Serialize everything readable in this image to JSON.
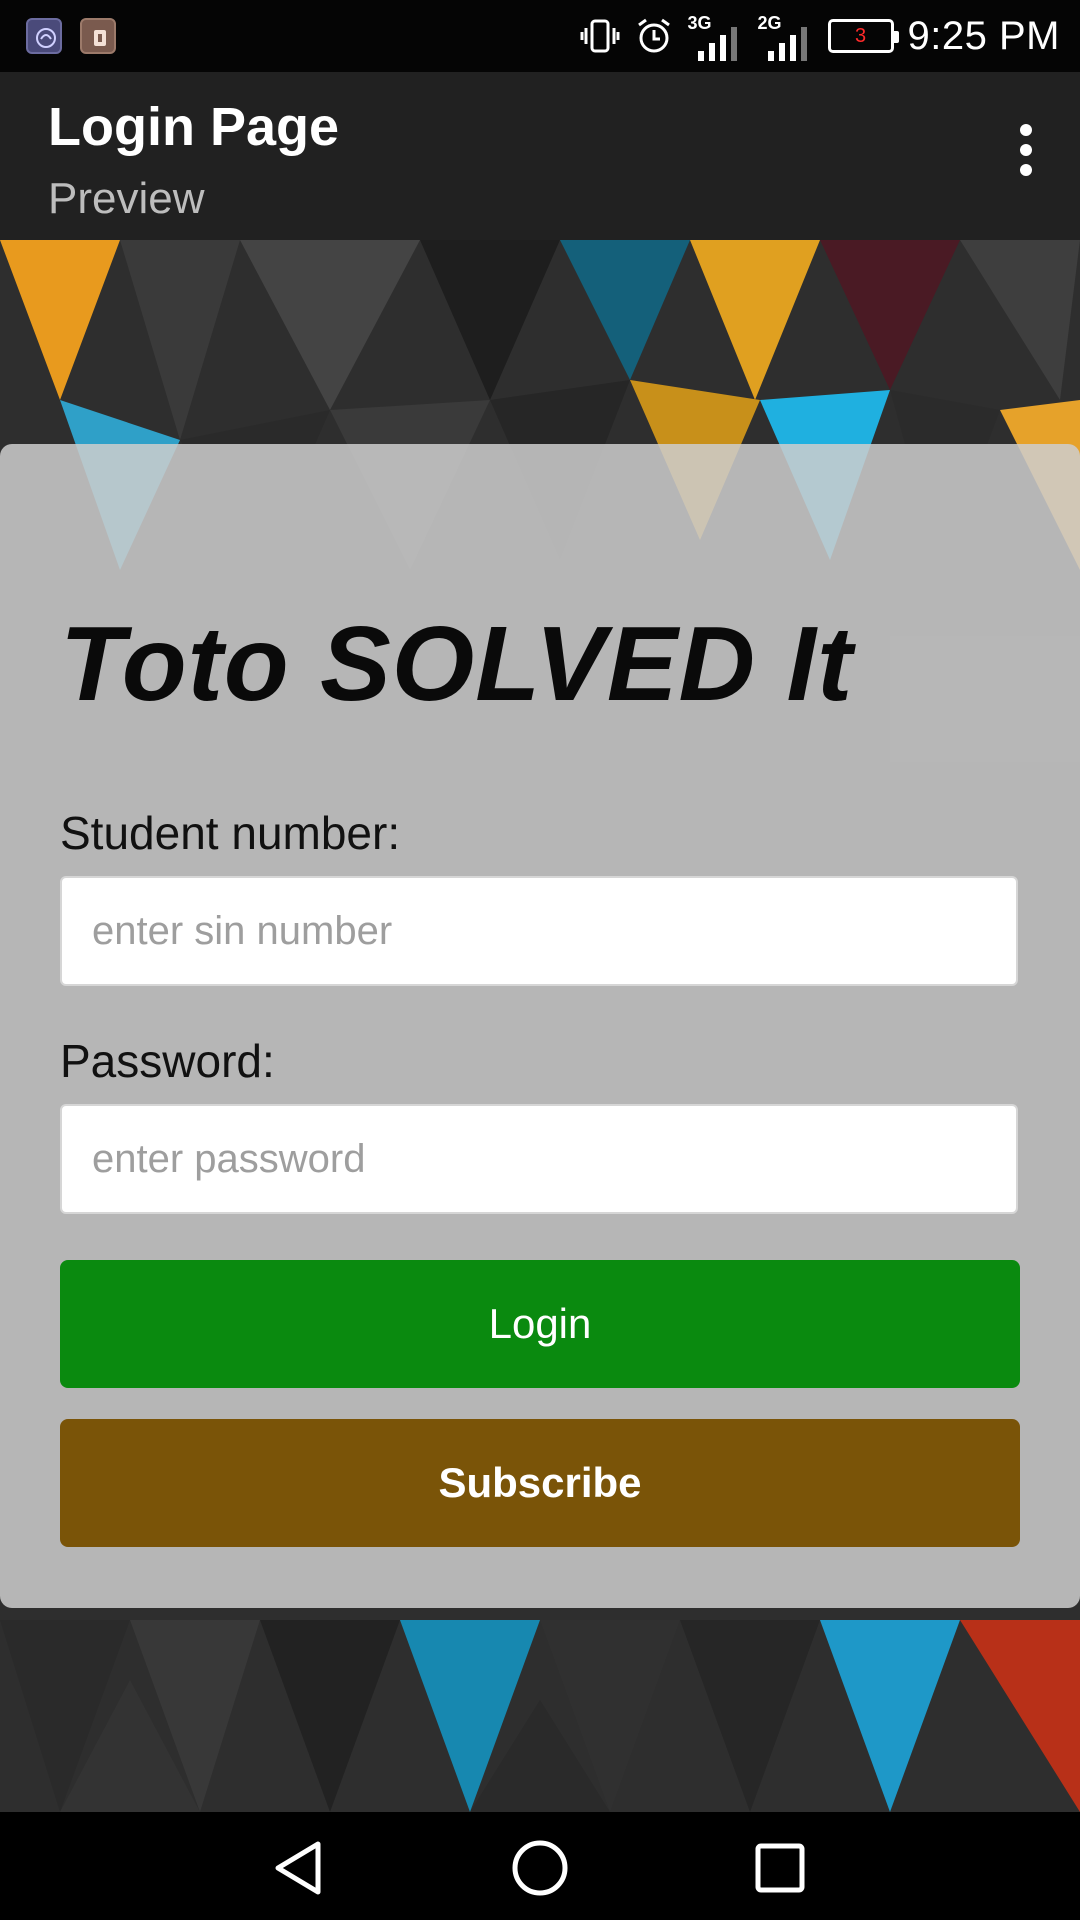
{
  "status_bar": {
    "app_icons": [
      "notification-app-icon",
      "notification-clipboard-icon"
    ],
    "network_1": "3G",
    "network_2": "2G",
    "battery_level": "3",
    "time": "9:25 PM"
  },
  "action_bar": {
    "title": "Login Page",
    "subtitle": "Preview",
    "menu_icon": "more-vert-icon"
  },
  "form": {
    "heading": "Toto SOLVED It",
    "student_label": "Student number:",
    "student_placeholder": "enter sin number",
    "student_value": "",
    "password_label": "Password:",
    "password_placeholder": "enter password",
    "password_value": "",
    "login_label": "Login",
    "subscribe_label": "Subscribe"
  },
  "nav_bar": {
    "back_icon": "back-triangle-icon",
    "home_icon": "home-circle-icon",
    "recents_icon": "recents-square-icon"
  },
  "colors": {
    "login_button": "#0a8a0f",
    "subscribe_button": "#7a5408",
    "action_bar": "#212121",
    "card_overlay": "#cdcdcd"
  }
}
